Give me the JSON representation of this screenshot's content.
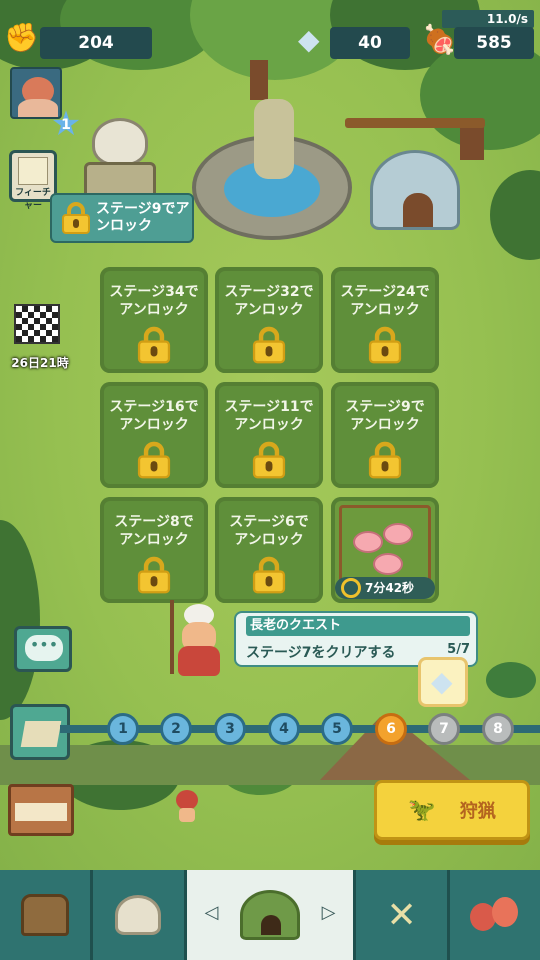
{
  "resources": {
    "strength": "204",
    "gems": "40",
    "meat": "585",
    "meat_rate": "11.0/s"
  },
  "player": {
    "level": "1"
  },
  "sidebar": {
    "feature_label": "フィーチャー",
    "event_timer": "26日21時"
  },
  "tooltip": {
    "text": "ステージ9でアンロック"
  },
  "plots": [
    {
      "label": "ステージ34でアンロック"
    },
    {
      "label": "ステージ32でアンロック"
    },
    {
      "label": "ステージ24でアンロック"
    },
    {
      "label": "ステージ16でアンロック"
    },
    {
      "label": "ステージ11でアンロック"
    },
    {
      "label": "ステージ9でアンロック"
    },
    {
      "label": "ステージ8でアンロック"
    },
    {
      "label": "ステージ6でアンロック"
    }
  ],
  "pig_pen": {
    "timer": "7分42秒"
  },
  "quest": {
    "title": "長老のクエスト",
    "text": "ステージ7をクリアする",
    "progress": "5/7"
  },
  "stages": [
    "1",
    "2",
    "3",
    "4",
    "5",
    "6",
    "7",
    "8"
  ],
  "current_stage": "6",
  "hunt_button": {
    "label": "狩猟"
  },
  "colors": {
    "grass": "#96c051",
    "panel": "#234a4e",
    "accent": "#f3a22d",
    "button": "#f4d23d"
  }
}
